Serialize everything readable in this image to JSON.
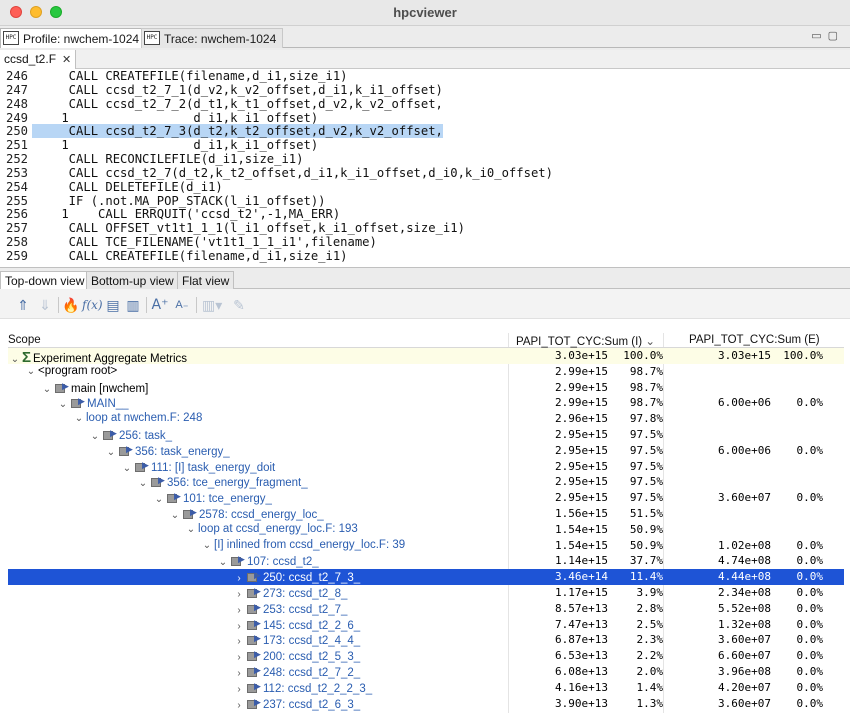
{
  "window": {
    "title": "hpcviewer"
  },
  "top_tabs": [
    {
      "icon": "HPC",
      "label": "Profile: nwchem-1024"
    },
    {
      "icon": "HPC",
      "label": "Trace: nwchem-1024"
    }
  ],
  "editor": {
    "file_tab": "ccsd_t2.F",
    "lines": [
      {
        "num": "246",
        "text": "     CALL CREATEFILE(filename,d_i1,size_i1)"
      },
      {
        "num": "247",
        "text": "     CALL ccsd_t2_7_1(d_v2,k_v2_offset,d_i1,k_i1_offset)"
      },
      {
        "num": "248",
        "text": "     CALL ccsd_t2_7_2(d_t1,k_t1_offset,d_v2,k_v2_offset,"
      },
      {
        "num": "249",
        "text": "    1                 d_i1,k_i1_offset)"
      },
      {
        "num": "250",
        "text": "     CALL ccsd_t2_7_3(d_t2,k_t2_offset,d_v2,k_v2_offset,"
      },
      {
        "num": "251",
        "text": "    1                 d_i1,k_i1_offset)"
      },
      {
        "num": "252",
        "text": "     CALL RECONCILEFILE(d_i1,size_i1)"
      },
      {
        "num": "253",
        "text": "     CALL ccsd_t2_7(d_t2,k_t2_offset,d_i1,k_i1_offset,d_i0,k_i0_offset)"
      },
      {
        "num": "254",
        "text": "     CALL DELETEFILE(d_i1)"
      },
      {
        "num": "255",
        "text": "     IF (.not.MA_POP_STACK(l_i1_offset))"
      },
      {
        "num": "256",
        "text": "    1    CALL ERRQUIT('ccsd_t2',-1,MA_ERR)"
      },
      {
        "num": "257",
        "text": "     CALL OFFSET_vt1t1_1_1(l_i1_offset,k_i1_offset,size_i1)"
      },
      {
        "num": "258",
        "text": "     CALL TCE_FILENAME('vt1t1_1_1_i1',filename)"
      },
      {
        "num": "259",
        "text": "     CALL CREATEFILE(filename,d_i1,size_i1)"
      }
    ]
  },
  "view_tabs": [
    "Top-down view",
    "Bottom-up view",
    "Flat view"
  ],
  "table": {
    "headers": {
      "scope": "Scope",
      "col_i": "PAPI_TOT_CYC:Sum (I)",
      "col_e": "PAPI_TOT_CYC:Sum (E)"
    },
    "rows": [
      {
        "scope": "Experiment Aggregate Metrics",
        "vi": "3.03e+15",
        "pi": "100.0%",
        "ve": "3.03e+15",
        "pe": "100.0%"
      },
      {
        "scope": "<program root>",
        "vi": "2.99e+15",
        "pi": "98.7%",
        "ve": "",
        "pe": ""
      },
      {
        "scope": "main [nwchem]",
        "vi": "2.99e+15",
        "pi": "98.7%",
        "ve": "",
        "pe": ""
      },
      {
        "scope": "MAIN__",
        "vi": "2.99e+15",
        "pi": "98.7%",
        "ve": "6.00e+06",
        "pe": "0.0%"
      },
      {
        "scope": "loop at nwchem.F: 248",
        "vi": "2.96e+15",
        "pi": "97.8%",
        "ve": "",
        "pe": ""
      },
      {
        "scope": "256: task_",
        "vi": "2.95e+15",
        "pi": "97.5%",
        "ve": "",
        "pe": ""
      },
      {
        "scope": "356: task_energy_",
        "vi": "2.95e+15",
        "pi": "97.5%",
        "ve": "6.00e+06",
        "pe": "0.0%"
      },
      {
        "scope": "111: [I] task_energy_doit",
        "vi": "2.95e+15",
        "pi": "97.5%",
        "ve": "",
        "pe": ""
      },
      {
        "scope": "356: tce_energy_fragment_",
        "vi": "2.95e+15",
        "pi": "97.5%",
        "ve": "",
        "pe": ""
      },
      {
        "scope": "101: tce_energy_",
        "vi": "2.95e+15",
        "pi": "97.5%",
        "ve": "3.60e+07",
        "pe": "0.0%"
      },
      {
        "scope": "2578: ccsd_energy_loc_",
        "vi": "1.56e+15",
        "pi": "51.5%",
        "ve": "",
        "pe": ""
      },
      {
        "scope": "loop at ccsd_energy_loc.F: 193",
        "vi": "1.54e+15",
        "pi": "50.9%",
        "ve": "",
        "pe": ""
      },
      {
        "scope": "[I] inlined from ccsd_energy_loc.F: 39",
        "vi": "1.54e+15",
        "pi": "50.9%",
        "ve": "1.02e+08",
        "pe": "0.0%"
      },
      {
        "scope": "107: ccsd_t2_",
        "vi": "1.14e+15",
        "pi": "37.7%",
        "ve": "4.74e+08",
        "pe": "0.0%"
      },
      {
        "scope": "250: ccsd_t2_7_3_",
        "vi": "3.46e+14",
        "pi": "11.4%",
        "ve": "4.44e+08",
        "pe": "0.0%"
      },
      {
        "scope": "273: ccsd_t2_8_",
        "vi": "1.17e+15",
        "pi": "3.9%",
        "ve": "2.34e+08",
        "pe": "0.0%"
      },
      {
        "scope": "253: ccsd_t2_7_",
        "vi": "8.57e+13",
        "pi": "2.8%",
        "ve": "5.52e+08",
        "pe": "0.0%"
      },
      {
        "scope": "145: ccsd_t2_2_6_",
        "vi": "7.47e+13",
        "pi": "2.5%",
        "ve": "1.32e+08",
        "pe": "0.0%"
      },
      {
        "scope": "173: ccsd_t2_4_4_",
        "vi": "6.87e+13",
        "pi": "2.3%",
        "ve": "3.60e+07",
        "pe": "0.0%"
      },
      {
        "scope": "200: ccsd_t2_5_3_",
        "vi": "6.53e+13",
        "pi": "2.2%",
        "ve": "6.60e+07",
        "pe": "0.0%"
      },
      {
        "scope": "248: ccsd_t2_7_2_",
        "vi": "6.08e+13",
        "pi": "2.0%",
        "ve": "3.96e+08",
        "pe": "0.0%"
      },
      {
        "scope": "112: ccsd_t2_2_2_3_",
        "vi": "4.16e+13",
        "pi": "1.4%",
        "ve": "4.20e+07",
        "pe": "0.0%"
      },
      {
        "scope": "237: ccsd_t2_6_3_",
        "vi": "3.90e+13",
        "pi": "1.3%",
        "ve": "3.60e+07",
        "pe": "0.0%"
      }
    ]
  }
}
